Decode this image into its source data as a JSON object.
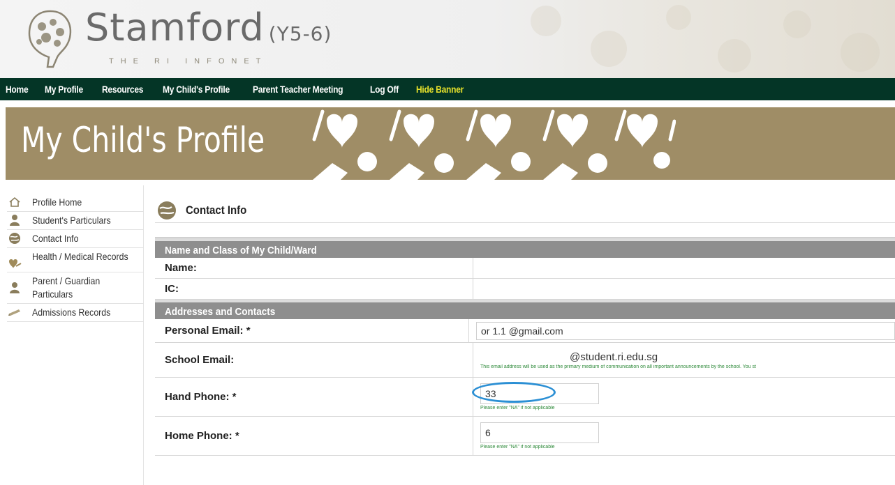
{
  "banner": {
    "title": "Stamford",
    "subtitle": "(Y5-6)",
    "tagline": "THE RI INFONET"
  },
  "nav": {
    "items": [
      {
        "label": "Home"
      },
      {
        "label": "My Profile"
      },
      {
        "label": "Resources"
      },
      {
        "label": "My Child's Profile"
      },
      {
        "label": "Parent Teacher Meeting"
      },
      {
        "label": "Log Off"
      },
      {
        "label": "Hide Banner"
      }
    ],
    "highlight_color": "#e6e12b"
  },
  "section_banner": {
    "title": "My Child's Profile"
  },
  "sidebar": {
    "items": [
      {
        "label": "Profile Home",
        "icon": "house-icon"
      },
      {
        "label": "Student's Particulars",
        "icon": "person-icon"
      },
      {
        "label": "Contact Info",
        "icon": "globe-icon"
      },
      {
        "label": "Health / Medical Records",
        "icon": "heart-hand-icon"
      },
      {
        "label": "Parent / Guardian Particulars",
        "icon": "person-icon"
      },
      {
        "label": "Admissions Records",
        "icon": "pencil-icon"
      }
    ]
  },
  "content": {
    "title": "Contact Info",
    "sections": {
      "name_class": {
        "heading": "Name and Class of My Child/Ward",
        "name_label": "Name:",
        "ic_label": "IC:"
      },
      "addresses": {
        "heading": "Addresses and Contacts",
        "personal_email_label": "Personal Email: *",
        "personal_email_value": "or 1.1 @gmail.com",
        "school_email_label": "School Email:",
        "school_email_value": "@student.ri.edu.sg",
        "school_email_note": "This email address will be used as the primary medium of communication on all important announcements by the school. You st",
        "hand_phone_label": "Hand Phone: *",
        "hand_phone_value": "33",
        "hand_phone_note": "Please enter \"NA\" if not applicable",
        "home_phone_label": "Home Phone: *",
        "home_phone_value": "6",
        "home_phone_note": "Please enter \"NA\" if not applicable"
      }
    }
  },
  "colors": {
    "nav_bg": "#043526",
    "banner_gold": "#9f8d66",
    "section_grey": "#8e8e8e",
    "note_green": "#2e8a3a",
    "circle_blue": "#2b8fd4"
  }
}
